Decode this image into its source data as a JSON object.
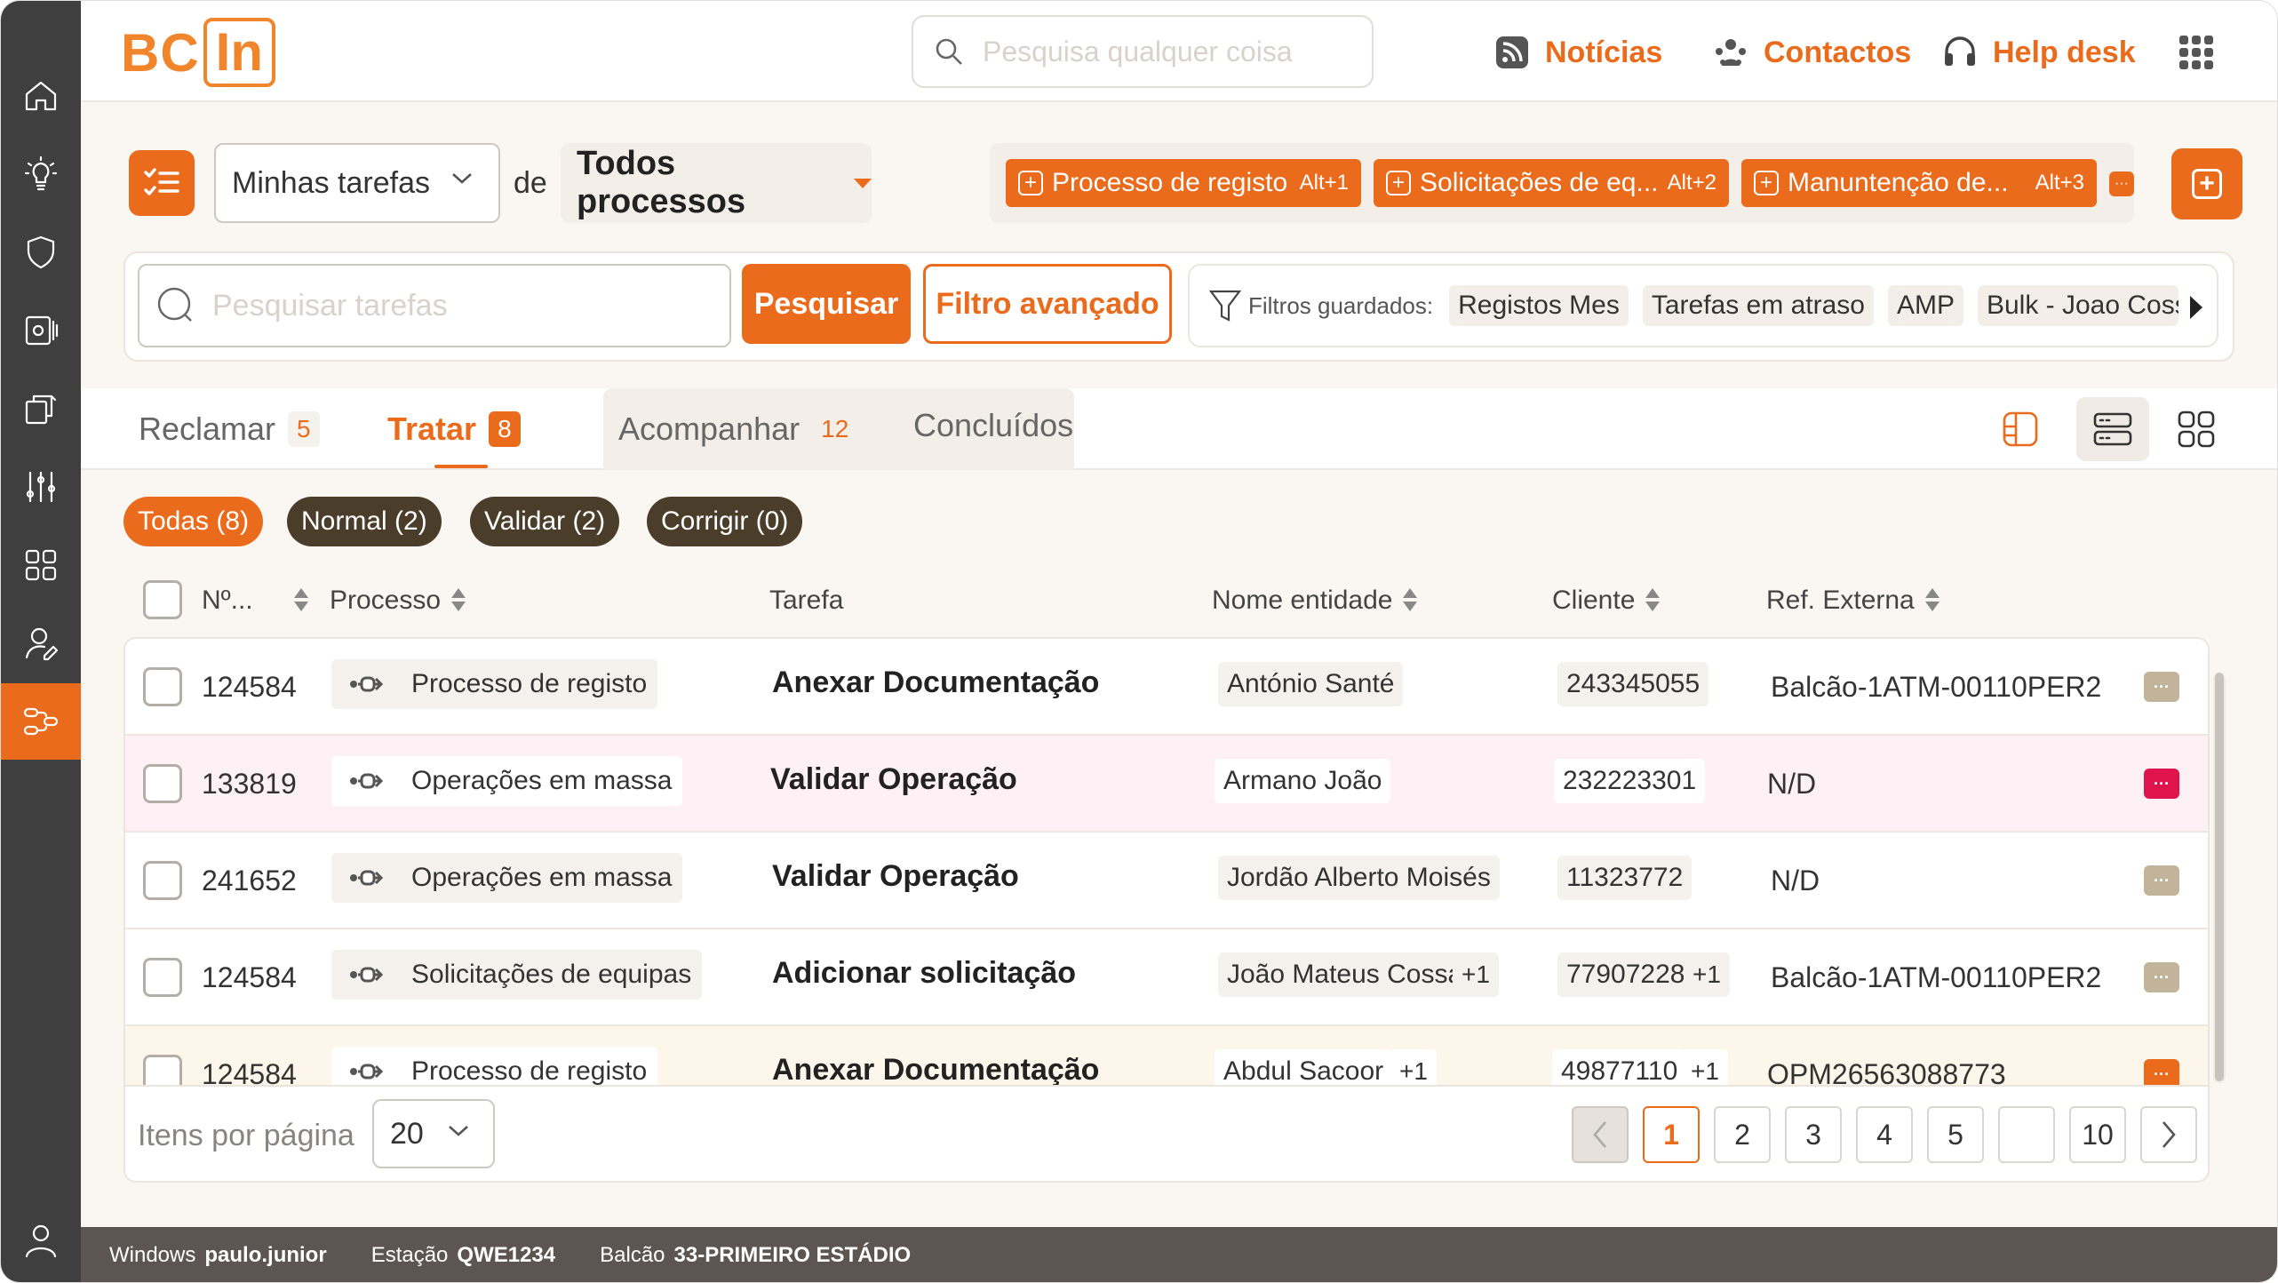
{
  "colors": {
    "accent": "#ea6b1c",
    "sidebar": "#3f3f3f",
    "chip_dark": "#4a3d2a",
    "pink_row": "#fdf1f5",
    "cream_row": "#fdf6ea",
    "more_gray": "#c2b49a",
    "more_red": "#e0144c"
  },
  "sidebar": {
    "items": [
      {
        "icon": "home-icon"
      },
      {
        "icon": "lightbulb-icon"
      },
      {
        "icon": "shield-icon"
      },
      {
        "icon": "settings-panel-icon"
      },
      {
        "icon": "documents-icon"
      },
      {
        "icon": "sliders-icon"
      },
      {
        "icon": "grid-icon"
      },
      {
        "icon": "user-edit-icon"
      },
      {
        "icon": "workflow-icon",
        "active": true
      }
    ],
    "profile_icon": "user-icon"
  },
  "header": {
    "logo_left": "BC",
    "logo_right": "In",
    "search_placeholder": "Pesquisa qualquer coisa",
    "links": [
      {
        "label": "Notícias",
        "icon": "rss-icon"
      },
      {
        "label": "Contactos",
        "icon": "contacts-icon"
      },
      {
        "label": "Help desk",
        "icon": "headset-icon"
      }
    ],
    "apps_icon": "apps-grid-icon"
  },
  "toolbar": {
    "task_select": "Minhas tarefas",
    "de_label": "de",
    "process_select": "Todos processos",
    "quick_actions": [
      {
        "label": "Processo de registo",
        "shortcut": "Alt+1"
      },
      {
        "label": "Solicitações de eq...",
        "shortcut": "Alt+2"
      },
      {
        "label": "Manuntenção de...",
        "shortcut": "Alt+3"
      }
    ],
    "more_label": "···"
  },
  "search": {
    "placeholder": "Pesquisar tarefas",
    "search_button": "Pesquisar",
    "advanced_button": "Filtro avançado",
    "saved_label": "Filtros guardados:",
    "saved_filters": [
      "Registos Mes",
      "Tarefas em atraso",
      "AMP",
      "Bulk - Joao Cossa"
    ]
  },
  "tabs": [
    {
      "label": "Reclamar",
      "count": "5"
    },
    {
      "label": "Tratar",
      "count": "8",
      "active": true
    },
    {
      "label": "Acompanhar",
      "count": "12"
    },
    {
      "label": "Concluídos",
      "count": ""
    }
  ],
  "filters": [
    {
      "label": "Todas (8)",
      "active": true
    },
    {
      "label": "Normal (2)"
    },
    {
      "label": "Validar (2)"
    },
    {
      "label": "Corrigir (0)"
    }
  ],
  "table": {
    "columns": {
      "num": "Nº...",
      "process": "Processo",
      "task": "Tarefa",
      "entity": "Nome entidade",
      "client": "Cliente",
      "ref": "Ref. Externa"
    },
    "rows": [
      {
        "num": "124584",
        "process": "Processo de registo",
        "task": "Anexar Documentação",
        "entity": "António Santé",
        "entity_more": "",
        "client": "243345055",
        "client_more": "",
        "ref": "Balcão-1ATM-00110PER2",
        "status": "normal"
      },
      {
        "num": "133819",
        "process": "Operações em massa",
        "task": "Validar Operação",
        "entity": "Armano João",
        "entity_more": "",
        "client": "232223301",
        "client_more": "",
        "ref": "N/D",
        "status": "urgent"
      },
      {
        "num": "241652",
        "process": "Operações em massa",
        "task": "Validar Operação",
        "entity": "Jordão Alberto Moisés",
        "entity_more": "",
        "client": "11323772",
        "client_more": "",
        "ref": "N/D",
        "status": "normal"
      },
      {
        "num": "124584",
        "process": "Solicitações de equipas",
        "task": "Adicionar solicitação",
        "entity": "João Mateus Cossa",
        "entity_more": "+1",
        "client": "77907228",
        "client_more": "+1",
        "ref": "Balcão-1ATM-00110PER2",
        "status": "normal"
      },
      {
        "num": "124584",
        "process": "Processo de registo",
        "task": "Anexar Documentação",
        "entity": "Abdul Sacoor",
        "entity_more": "+1",
        "client": "49877110",
        "client_more": "+1",
        "ref": "OPM26563088773",
        "status": "warning"
      }
    ],
    "more_label": "···"
  },
  "pagination": {
    "items_label": "Itens por página",
    "items_value": "20",
    "pages": [
      "1",
      "2",
      "3",
      "4",
      "5",
      "",
      "10"
    ],
    "current": "1"
  },
  "footer": {
    "windows_label": "Windows",
    "windows_user": "paulo.junior",
    "station_label": "Estação",
    "station": "QWE1234",
    "desk_label": "Balcão",
    "desk": "33-PRIMEIRO ESTÁDIO"
  }
}
